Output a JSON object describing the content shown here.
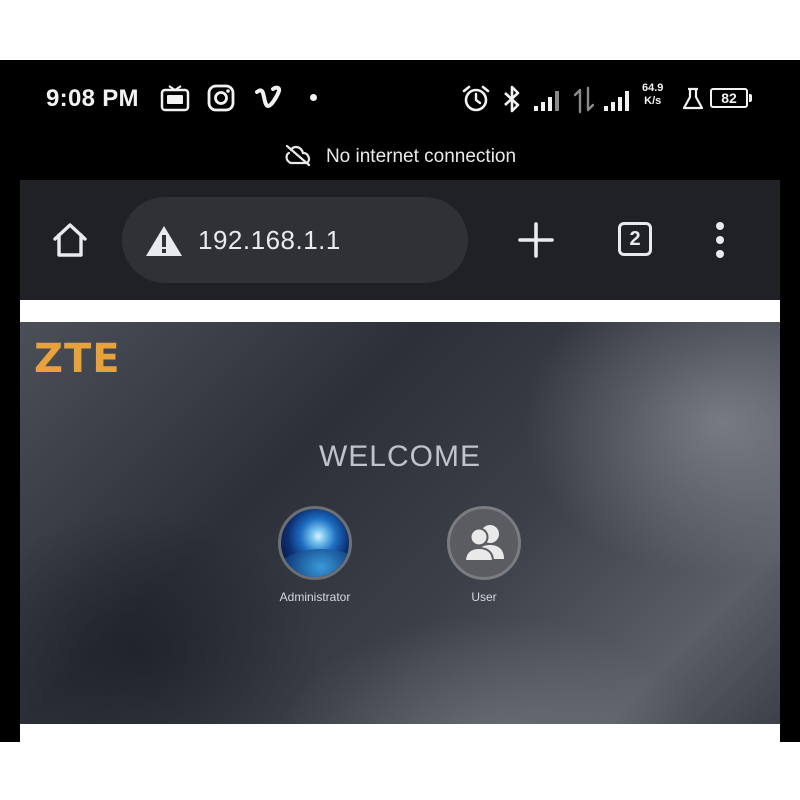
{
  "status_bar": {
    "time": "9:08 PM",
    "network_speed_value": "64.9",
    "network_speed_unit": "K/s",
    "battery_level": "82",
    "icons": [
      "tv-icon",
      "instagram-icon",
      "vimeo-icon",
      "alarm-icon",
      "bluetooth-icon",
      "signal-icon",
      "data-arrows-icon",
      "signal-icon",
      "lab-flask-icon",
      "battery-icon"
    ]
  },
  "connection_banner": {
    "text": "No internet connection",
    "icon": "cloud-off-icon"
  },
  "browser": {
    "url": "192.168.1.1",
    "security_icon": "warning-icon",
    "tab_count": "2",
    "colors": {
      "toolbar": "#202124",
      "omnibox": "#303134",
      "text": "#e8eaed"
    }
  },
  "page": {
    "logo_text": "ZTE",
    "heading": "WELCOME",
    "accounts": [
      {
        "label": "Administrator",
        "icon": "earth-avatar-icon"
      },
      {
        "label": "User",
        "icon": "user-group-icon"
      }
    ],
    "colors": {
      "logo": "#e8a23a"
    }
  }
}
